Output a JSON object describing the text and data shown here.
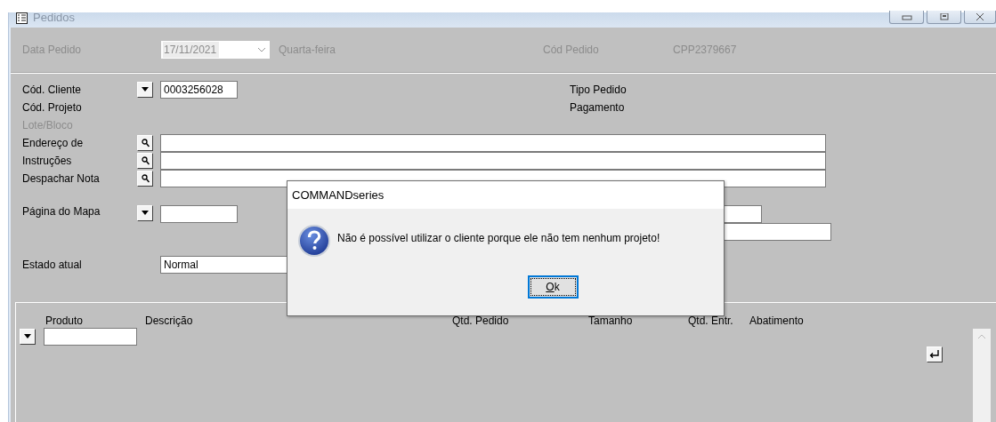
{
  "window": {
    "title": "Pedidos"
  },
  "header": {
    "date_label": "Data Pedido",
    "date_value": "17/11/2021",
    "weekday": "Quarta-feira",
    "order_label": "Cód Pedido",
    "order_value": "CPP2379667",
    "disabled": true
  },
  "fields": [
    {
      "label": "Cód. Cliente",
      "kind": "dropdown",
      "value": "0003256028",
      "disabled": false,
      "side_label": "Tipo Pedido"
    },
    {
      "label": "Cód. Projeto",
      "kind": "label",
      "disabled": false,
      "side_label": "Pagamento"
    },
    {
      "label": "Lote/Bloco",
      "kind": "label",
      "disabled": true
    },
    {
      "label": "Endereço de",
      "kind": "lookup",
      "disabled": false
    },
    {
      "label": "Instruções",
      "kind": "lookup",
      "disabled": false
    },
    {
      "label": "Despachar Nota",
      "kind": "lookup",
      "disabled": false
    }
  ],
  "map_page": {
    "label": "Página do Mapa"
  },
  "status": {
    "label": "Estado atual",
    "value": "Normal"
  },
  "grid": {
    "columns": [
      "Produto",
      "Descrição",
      "Qtd. Pedido",
      "Tamanho",
      "Qtd. Entr.",
      "Abatimento"
    ]
  },
  "dialog": {
    "title": "COMMANDseries",
    "message": "Não é possível utilizar o cliente porque ele não tem nenhum projeto!",
    "button": "Ok"
  }
}
